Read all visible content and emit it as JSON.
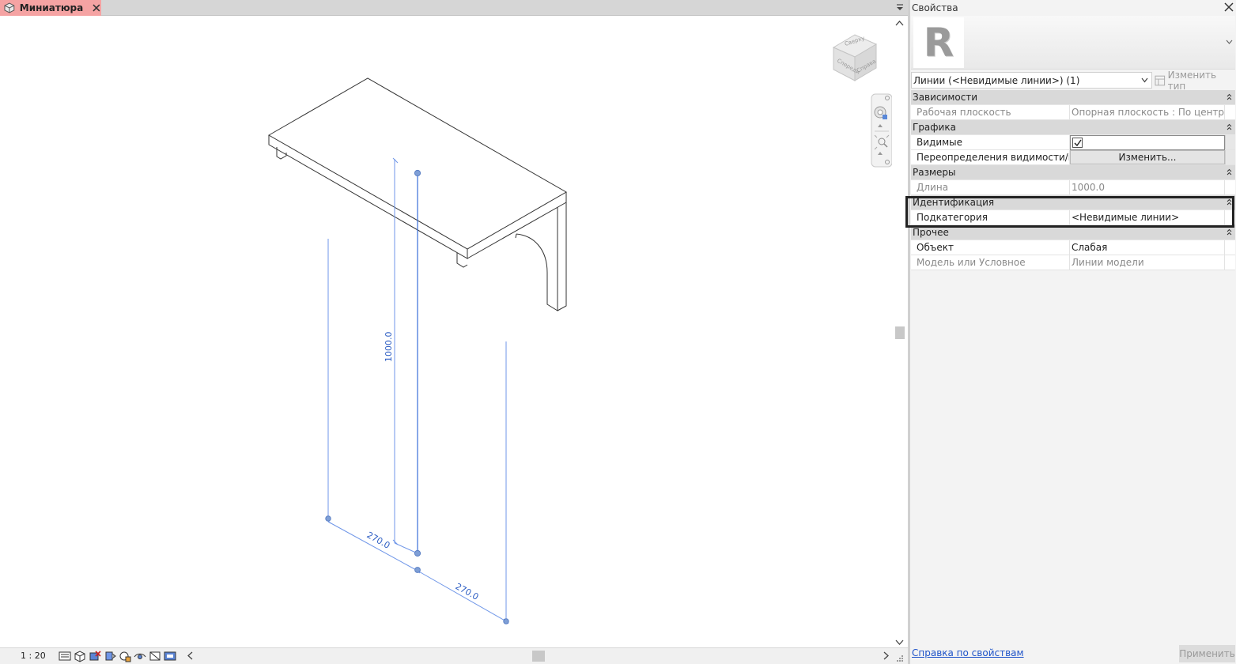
{
  "view": {
    "tab_label": "Миниатюра",
    "scale": "1 : 20",
    "viewcube": {
      "top_face": "Сверху",
      "left_face": "Спереди",
      "right_face": "Справа"
    },
    "dimensions": {
      "vertical": "1000.0",
      "bottom_left": "270.0",
      "bottom_right": "270.0"
    }
  },
  "properties": {
    "title": "Свойства",
    "type_selector": "Линии (<Невидимые линии>) (1)",
    "edit_type_label": "Изменить тип",
    "categories": [
      {
        "name": "Зависимости",
        "rows": [
          {
            "name": "Рабочая плоскость",
            "value": "Опорная плоскость : По центру (...",
            "readonly": true
          }
        ]
      },
      {
        "name": "Графика",
        "rows": [
          {
            "name": "Видимые",
            "value": "checked"
          },
          {
            "name": "Переопределения видимости/гр...",
            "value": "Изменить..."
          }
        ]
      },
      {
        "name": "Размеры",
        "rows": [
          {
            "name": "Длина",
            "value": "1000.0",
            "readonly": true
          }
        ]
      },
      {
        "name": "Идентификация",
        "rows": [
          {
            "name": "Подкатегория",
            "value": "<Невидимые линии>"
          }
        ]
      },
      {
        "name": "Прочее",
        "rows": [
          {
            "name": "Объект",
            "value": "Слабая"
          },
          {
            "name": "Модель или Условное",
            "value": "Линии модели",
            "readonly": true
          }
        ]
      }
    ],
    "help_link": "Справка по свойствам",
    "apply_label": "Применить"
  },
  "colors": {
    "tab_bg": "#f5a3a3",
    "dimension_blue": "#3a6fd8",
    "highlight_border": "#222222"
  }
}
